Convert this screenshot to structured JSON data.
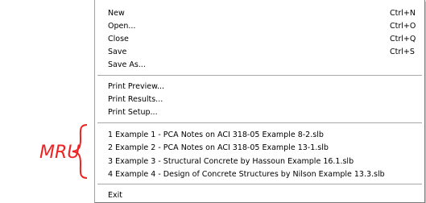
{
  "menu": {
    "items": [
      {
        "label": "New",
        "shortcut": "Ctrl+N"
      },
      {
        "label": "Open...",
        "shortcut": "Ctrl+O"
      },
      {
        "label": "Close",
        "shortcut": "Ctrl+Q"
      },
      {
        "label": "Save",
        "shortcut": "Ctrl+S"
      },
      {
        "label": "Save As...",
        "shortcut": ""
      },
      {
        "label": "Print Preview...",
        "shortcut": ""
      },
      {
        "label": "Print Results...",
        "shortcut": ""
      },
      {
        "label": "Print Setup...",
        "shortcut": ""
      },
      {
        "label": "1 Example 1 - PCA Notes on ACI 318-05 Example 8-2.slb",
        "shortcut": ""
      },
      {
        "label": "2 Example 2 - PCA Notes on ACI 318-05 Example 13-1.slb",
        "shortcut": ""
      },
      {
        "label": "3 Example 3 - Structural Concrete by Hassoun Example 16.1.slb",
        "shortcut": ""
      },
      {
        "label": "4 Example 4 - Design of Concrete Structures by Nilson Example 13.3.slb",
        "shortcut": ""
      },
      {
        "label": "Exit",
        "shortcut": ""
      }
    ]
  },
  "annotation": {
    "label": "MRU",
    "color": "#ee2222",
    "icon": "curly-brace-icon"
  }
}
